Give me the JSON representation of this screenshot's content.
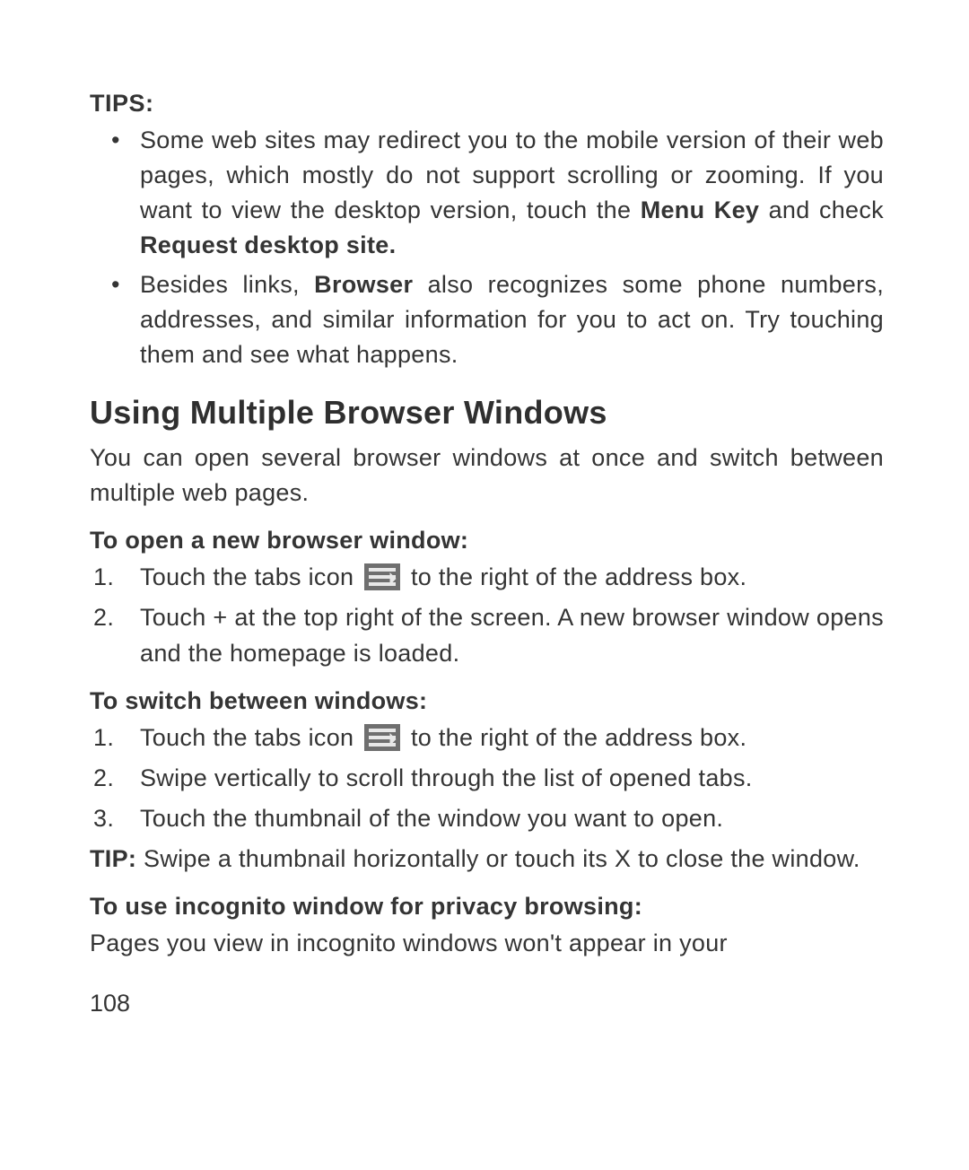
{
  "tips_label": "TIPS:",
  "tips": {
    "item1_a": "Some web sites may redirect you to the mobile version of their web pages, which mostly do not support scrolling or zooming. If you want to view the desktop version, touch the ",
    "item1_b1": "Menu Key",
    "item1_c": " and check ",
    "item1_b2": "Request desktop site.",
    "item2_a": "Besides links, ",
    "item2_b": "Browser",
    "item2_c": " also recognizes some phone numbers, addresses, and similar information for you to act on. Try touching them and see what happens."
  },
  "heading": "Using Multiple Browser Windows",
  "intro": "You can open several browser windows at once and switch between multiple web pages.",
  "sub_open": "To open a new browser window:",
  "open_steps": {
    "s1a": "Touch the tabs icon ",
    "s1b": " to the right of the address box.",
    "s2": "Touch + at the top right of the screen. A new browser window opens and the homepage is loaded."
  },
  "sub_switch": "To switch between windows:",
  "switch_steps": {
    "s1a": "Touch the tabs icon ",
    "s1b": " to the right of the address box.",
    "s2": "Swipe vertically to scroll through the list of opened tabs.",
    "s3": "Touch the thumbnail of the window you want to open."
  },
  "tip2_label": "TIP:",
  "tip2_text": " Swipe a thumbnail horizontally or touch its X to close the window.",
  "sub_incognito": "To use incognito window for privacy browsing:",
  "incognito_text": "Pages you view in incognito windows won't appear in your",
  "page_number": "108"
}
